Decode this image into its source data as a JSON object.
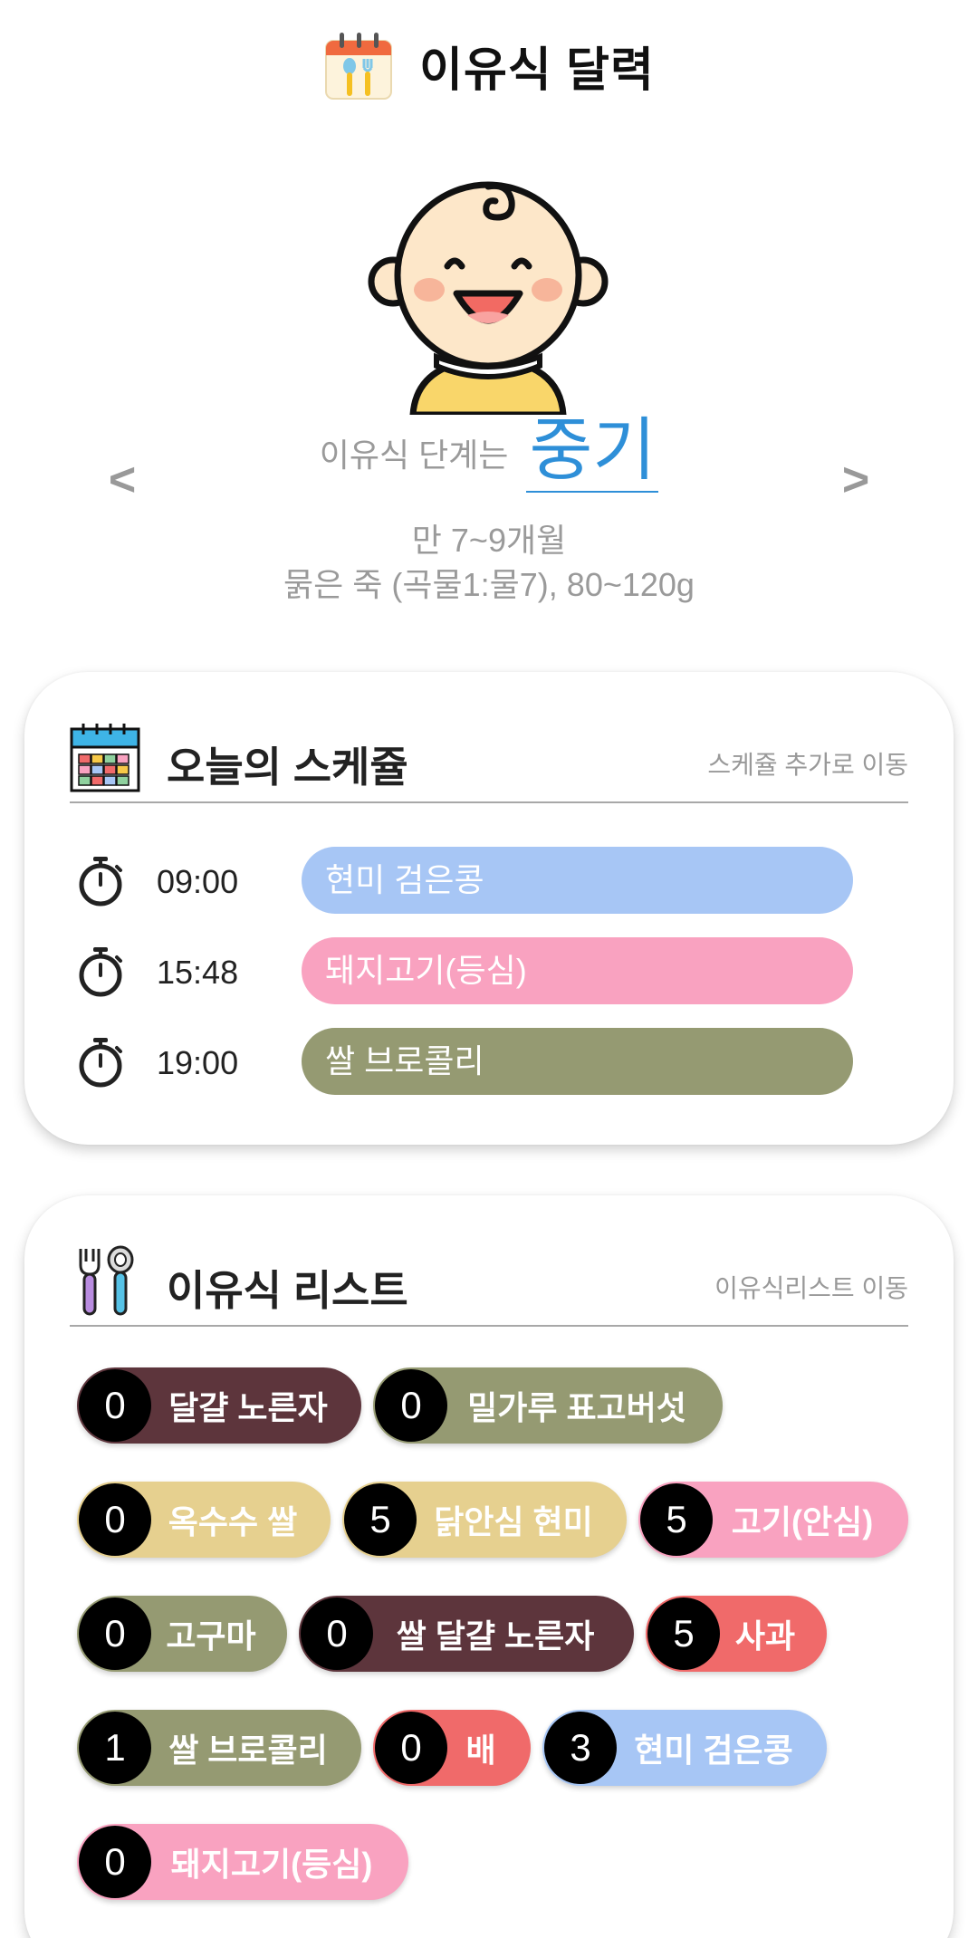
{
  "header": {
    "title": "이유식 달력"
  },
  "stage": {
    "prefix": "이유식 단계는",
    "name": "중기",
    "age_range": "만 7~9개월",
    "description": "묽은 죽 (곡물1:물7), 80~120g",
    "prev_label": "<",
    "next_label": ">"
  },
  "schedule": {
    "title": "오늘의 스케쥴",
    "link": "스케쥴 추가로 이동",
    "items": [
      {
        "time": "09:00",
        "food": "현미 검은콩",
        "color": "#a7c6f5"
      },
      {
        "time": "15:48",
        "food": "돼지고기(등심)",
        "color": "#f9a2c0"
      },
      {
        "time": "19:00",
        "food": "쌀 브로콜리",
        "color": "#959a72"
      }
    ]
  },
  "food_list": {
    "title": "이유식 리스트",
    "link": "이유식리스트 이동",
    "items": [
      {
        "count": "0",
        "name": "달걀 노른자",
        "color": "#5d353c"
      },
      {
        "count": "0",
        "name": "밀가루 표고버섯",
        "color": "#959a72"
      },
      {
        "count": "0",
        "name": "옥수수 쌀",
        "color": "#e6d08f"
      },
      {
        "count": "5",
        "name": "닭안심 현미",
        "color": "#e6d08f"
      },
      {
        "count": "5",
        "name": "고기(안심)",
        "color": "#f9a2c0"
      },
      {
        "count": "0",
        "name": "고구마",
        "color": "#959a72"
      },
      {
        "count": "0",
        "name": "쌀 달걀 노른자",
        "color": "#5d353c"
      },
      {
        "count": "5",
        "name": "사과",
        "color": "#f06a6a"
      },
      {
        "count": "1",
        "name": "쌀 브로콜리",
        "color": "#959a72"
      },
      {
        "count": "0",
        "name": "배",
        "color": "#f06a6a"
      },
      {
        "count": "3",
        "name": "현미 검은콩",
        "color": "#a7c6f5"
      },
      {
        "count": "0",
        "name": "돼지고기(등심)",
        "color": "#f9a2c0"
      }
    ]
  },
  "icons": {
    "app": "calendar-spoon-icon",
    "baby": "baby-face-icon",
    "schedule": "calendar-icon",
    "timer": "stopwatch-icon",
    "list": "fork-spoon-icon"
  }
}
